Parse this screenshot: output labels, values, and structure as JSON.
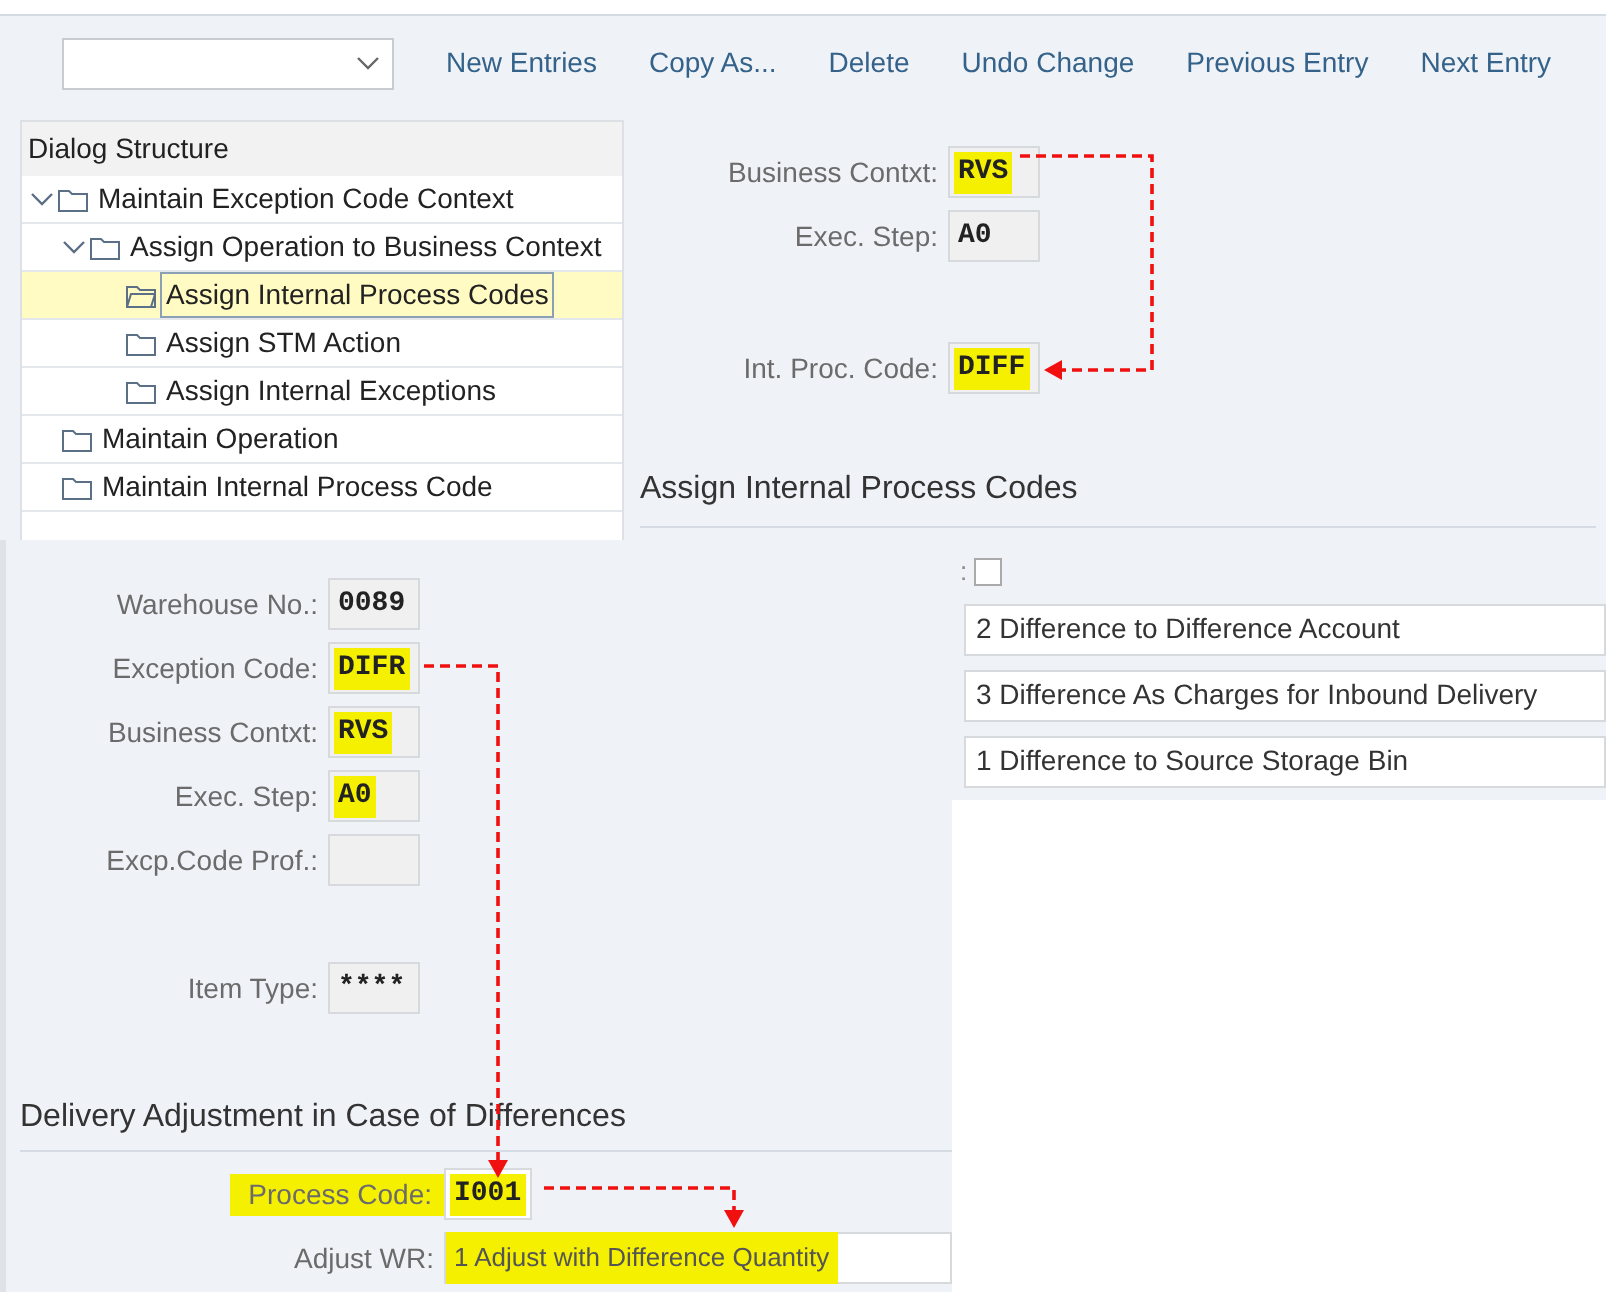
{
  "toolbar": {
    "buttons": [
      "New Entries",
      "Copy As...",
      "Delete",
      "Undo Change",
      "Previous Entry",
      "Next Entry"
    ]
  },
  "dialog_structure": {
    "title": "Dialog Structure",
    "items": [
      {
        "label": "Maintain Exception Code Context",
        "expanded": true,
        "selected": false,
        "children": [
          {
            "label": "Assign Operation to Business Context",
            "expanded": true,
            "selected": false,
            "children": [
              {
                "label": "Assign Internal Process Codes",
                "selected": true
              },
              {
                "label": "Assign STM Action",
                "selected": false
              },
              {
                "label": "Assign Internal Exceptions",
                "selected": false
              }
            ]
          }
        ]
      },
      {
        "label": "Maintain Operation",
        "selected": false
      },
      {
        "label": "Maintain Internal Process Code",
        "selected": false
      }
    ]
  },
  "detail": {
    "fields": [
      {
        "label": "Business Contxt:",
        "value": "RVS",
        "highlighted": true
      },
      {
        "label": "Exec. Step:",
        "value": "A0",
        "highlighted": false
      },
      {
        "label": "Int. Proc. Code:",
        "value": "DIFF",
        "highlighted": true
      }
    ],
    "section_title": "Assign Internal Process Codes",
    "checkbox": {
      "label": ":",
      "checked": false
    },
    "options": [
      "2 Difference to Difference Account",
      "3 Difference As Charges for Inbound Delivery",
      "1 Difference to Source Storage Bin"
    ]
  },
  "exception_screen": {
    "fields": [
      {
        "label": "Warehouse No.:",
        "value": "0089",
        "highlighted": false
      },
      {
        "label": "Exception Code:",
        "value": "DIFR",
        "highlighted": true
      },
      {
        "label": "Business Contxt:",
        "value": "RVS",
        "highlighted": true
      },
      {
        "label": "Exec. Step:",
        "value": "A0",
        "highlighted": true
      },
      {
        "label": "Excp.Code Prof.:"
      },
      {
        "label": "Item Type:",
        "value": "****",
        "highlighted": false
      }
    ],
    "section_title": "Delivery Adjustment in Case of Differences",
    "process_code": {
      "label": "Process Code:",
      "value": "I001",
      "highlighted": true
    },
    "adjust_wr": {
      "label": "Adjust WR:",
      "value": "1 Adjust with Difference Quantity",
      "highlighted": true
    }
  }
}
